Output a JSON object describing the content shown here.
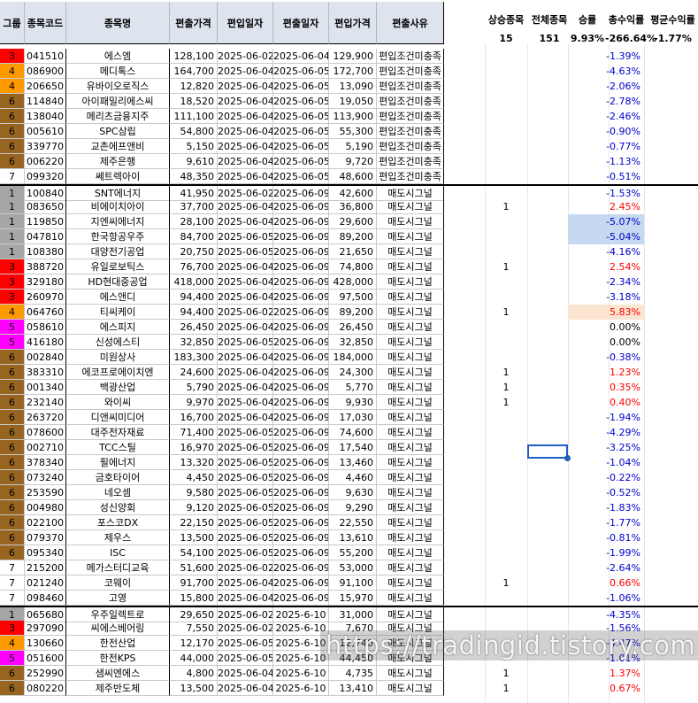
{
  "colors": {
    "grade_1": "#a6a6a6",
    "grade_3": "#ff0000",
    "grade_4": "#ff9900",
    "grade_5": "#ff00ff",
    "grade_6": "#976520",
    "grade_7": "#ffffff",
    "header_bg": "#dde4ee",
    "positive": "#ff0000",
    "negative": "#0000cc",
    "zero": "#000000",
    "highlight_blue": "#c5d9f1",
    "highlight_orange": "#fbe4d0"
  },
  "headers": [
    "그룹",
    "종목코드",
    "종목명",
    "편출가격",
    "편입일자",
    "편출일자",
    "편입가격",
    "편출사유"
  ],
  "summary": {
    "labels": [
      "상승종목",
      "전체종목",
      "승률",
      "총수익률",
      "평균수익률"
    ],
    "values": [
      "15",
      "151",
      "9.93%",
      "-266.64%",
      "-1.77%"
    ]
  },
  "rows": [
    {
      "grp": "3",
      "code": "041510",
      "name": "에스엠",
      "sell": "128,100",
      "in": "2025-06-02",
      "out": "2025-06-04",
      "buy": "129,900",
      "reason": "편입조건미충족",
      "up": "",
      "ret": "-1.39%"
    },
    {
      "grp": "4",
      "code": "086900",
      "name": "메디톡스",
      "sell": "164,700",
      "in": "2025-06-04",
      "out": "2025-06-05",
      "buy": "172,700",
      "reason": "편입조건미충족",
      "up": "",
      "ret": "-4.63%"
    },
    {
      "grp": "4",
      "code": "206650",
      "name": "유바이오로직스",
      "sell": "12,820",
      "in": "2025-06-04",
      "out": "2025-06-05",
      "buy": "13,090",
      "reason": "편입조건미충족",
      "up": "",
      "ret": "-2.06%"
    },
    {
      "grp": "6",
      "code": "114840",
      "name": "아이패밀리에스씨",
      "sell": "18,520",
      "in": "2025-06-04",
      "out": "2025-06-05",
      "buy": "19,050",
      "reason": "편입조건미충족",
      "up": "",
      "ret": "-2.78%"
    },
    {
      "grp": "6",
      "code": "138040",
      "name": "메리츠금융지주",
      "sell": "111,100",
      "in": "2025-06-04",
      "out": "2025-06-05",
      "buy": "113,900",
      "reason": "편입조건미충족",
      "up": "",
      "ret": "-2.46%"
    },
    {
      "grp": "6",
      "code": "005610",
      "name": "SPC삼립",
      "sell": "54,800",
      "in": "2025-06-04",
      "out": "2025-06-05",
      "buy": "55,300",
      "reason": "편입조건미충족",
      "up": "",
      "ret": "-0.90%"
    },
    {
      "grp": "6",
      "code": "339770",
      "name": "교촌에프앤비",
      "sell": "5,150",
      "in": "2025-06-04",
      "out": "2025-06-05",
      "buy": "5,190",
      "reason": "편입조건미충족",
      "up": "",
      "ret": "-0.77%"
    },
    {
      "grp": "6",
      "code": "006220",
      "name": "제주은행",
      "sell": "9,610",
      "in": "2025-06-04",
      "out": "2025-06-05",
      "buy": "9,720",
      "reason": "편입조건미충족",
      "up": "",
      "ret": "-1.13%"
    },
    {
      "grp": "7",
      "code": "099320",
      "name": "쎄트렉아이",
      "sell": "48,350",
      "in": "2025-06-04",
      "out": "2025-06-05",
      "buy": "48,600",
      "reason": "편입조건미충족",
      "up": "",
      "ret": "-0.51%"
    },
    {
      "grp": "1",
      "code": "100840",
      "name": "SNT에너지",
      "sell": "41,950",
      "in": "2025-06-02",
      "out": "2025-06-09",
      "buy": "42,600",
      "reason": "매도시그널",
      "up": "",
      "ret": "-1.53%"
    },
    {
      "grp": "1",
      "code": "083650",
      "name": "비에이치아이",
      "sell": "37,700",
      "in": "2025-06-04",
      "out": "2025-06-09",
      "buy": "36,800",
      "reason": "매도시그널",
      "up": "1",
      "ret": "2.45%"
    },
    {
      "grp": "1",
      "code": "119850",
      "name": "지엔씨에너지",
      "sell": "28,100",
      "in": "2025-06-04",
      "out": "2025-06-09",
      "buy": "29,600",
      "reason": "매도시그널",
      "up": "",
      "ret": "-5.07%",
      "hl": "blue"
    },
    {
      "grp": "1",
      "code": "047810",
      "name": "한국항공우주",
      "sell": "84,700",
      "in": "2025-06-05",
      "out": "2025-06-09",
      "buy": "89,200",
      "reason": "매도시그널",
      "up": "",
      "ret": "-5.04%",
      "hl": "blue"
    },
    {
      "grp": "1",
      "code": "108380",
      "name": "대양전기공업",
      "sell": "20,750",
      "in": "2025-06-05",
      "out": "2025-06-09",
      "buy": "21,650",
      "reason": "매도시그널",
      "up": "",
      "ret": "-4.16%"
    },
    {
      "grp": "3",
      "code": "388720",
      "name": "유일로보틱스",
      "sell": "76,700",
      "in": "2025-06-04",
      "out": "2025-06-09",
      "buy": "74,800",
      "reason": "매도시그널",
      "up": "1",
      "ret": "2.54%"
    },
    {
      "grp": "3",
      "code": "329180",
      "name": "HD현대중공업",
      "sell": "418,000",
      "in": "2025-06-04",
      "out": "2025-06-09",
      "buy": "428,000",
      "reason": "매도시그널",
      "up": "",
      "ret": "-2.34%"
    },
    {
      "grp": "3",
      "code": "260970",
      "name": "에스앤디",
      "sell": "94,400",
      "in": "2025-06-04",
      "out": "2025-06-09",
      "buy": "97,500",
      "reason": "매도시그널",
      "up": "",
      "ret": "-3.18%"
    },
    {
      "grp": "4",
      "code": "064760",
      "name": "티씨케이",
      "sell": "94,400",
      "in": "2025-06-02",
      "out": "2025-06-09",
      "buy": "89,200",
      "reason": "매도시그널",
      "up": "1",
      "ret": "5.83%",
      "hl": "orange"
    },
    {
      "grp": "5",
      "code": "058610",
      "name": "에스피지",
      "sell": "26,450",
      "in": "2025-06-04",
      "out": "2025-06-09",
      "buy": "26,450",
      "reason": "매도시그널",
      "up": "",
      "ret": "0.00%"
    },
    {
      "grp": "5",
      "code": "416180",
      "name": "신성에스티",
      "sell": "32,850",
      "in": "2025-06-05",
      "out": "2025-06-09",
      "buy": "32,850",
      "reason": "매도시그널",
      "up": "",
      "ret": "0.00%"
    },
    {
      "grp": "6",
      "code": "002840",
      "name": "미원상사",
      "sell": "183,300",
      "in": "2025-06-04",
      "out": "2025-06-09",
      "buy": "184,000",
      "reason": "매도시그널",
      "up": "",
      "ret": "-0.38%"
    },
    {
      "grp": "6",
      "code": "383310",
      "name": "에코프로에이치엔",
      "sell": "24,600",
      "in": "2025-06-04",
      "out": "2025-06-09",
      "buy": "24,300",
      "reason": "매도시그널",
      "up": "1",
      "ret": "1.23%"
    },
    {
      "grp": "6",
      "code": "001340",
      "name": "백광산업",
      "sell": "5,790",
      "in": "2025-06-04",
      "out": "2025-06-09",
      "buy": "5,770",
      "reason": "매도시그널",
      "up": "1",
      "ret": "0.35%"
    },
    {
      "grp": "6",
      "code": "232140",
      "name": "와이씨",
      "sell": "9,970",
      "in": "2025-06-04",
      "out": "2025-06-09",
      "buy": "9,930",
      "reason": "매도시그널",
      "up": "1",
      "ret": "0.40%"
    },
    {
      "grp": "6",
      "code": "263720",
      "name": "디앤씨미디어",
      "sell": "16,700",
      "in": "2025-06-04",
      "out": "2025-06-09",
      "buy": "17,030",
      "reason": "매도시그널",
      "up": "",
      "ret": "-1.94%"
    },
    {
      "grp": "6",
      "code": "078600",
      "name": "대주전자재료",
      "sell": "71,400",
      "in": "2025-06-05",
      "out": "2025-06-09",
      "buy": "74,600",
      "reason": "매도시그널",
      "up": "",
      "ret": "-4.29%"
    },
    {
      "grp": "6",
      "code": "002710",
      "name": "TCC스틸",
      "sell": "16,970",
      "in": "2025-06-05",
      "out": "2025-06-09",
      "buy": "17,540",
      "reason": "매도시그널",
      "up": "",
      "ret": "-3.25%"
    },
    {
      "grp": "6",
      "code": "378340",
      "name": "필에너지",
      "sell": "13,320",
      "in": "2025-06-05",
      "out": "2025-06-09",
      "buy": "13,460",
      "reason": "매도시그널",
      "up": "",
      "ret": "-1.04%"
    },
    {
      "grp": "6",
      "code": "073240",
      "name": "금호타이어",
      "sell": "4,450",
      "in": "2025-06-05",
      "out": "2025-06-09",
      "buy": "4,460",
      "reason": "매도시그널",
      "up": "",
      "ret": "-0.22%"
    },
    {
      "grp": "6",
      "code": "253590",
      "name": "네오셈",
      "sell": "9,580",
      "in": "2025-06-05",
      "out": "2025-06-09",
      "buy": "9,630",
      "reason": "매도시그널",
      "up": "",
      "ret": "-0.52%"
    },
    {
      "grp": "6",
      "code": "004980",
      "name": "성신양회",
      "sell": "9,120",
      "in": "2025-06-05",
      "out": "2025-06-09",
      "buy": "9,290",
      "reason": "매도시그널",
      "up": "",
      "ret": "-1.83%"
    },
    {
      "grp": "6",
      "code": "022100",
      "name": "포스코DX",
      "sell": "22,150",
      "in": "2025-06-05",
      "out": "2025-06-09",
      "buy": "22,550",
      "reason": "매도시그널",
      "up": "",
      "ret": "-1.77%"
    },
    {
      "grp": "6",
      "code": "079370",
      "name": "제우스",
      "sell": "13,500",
      "in": "2025-06-05",
      "out": "2025-06-09",
      "buy": "13,610",
      "reason": "매도시그널",
      "up": "",
      "ret": "-0.81%"
    },
    {
      "grp": "6",
      "code": "095340",
      "name": "ISC",
      "sell": "54,100",
      "in": "2025-06-05",
      "out": "2025-06-09",
      "buy": "55,200",
      "reason": "매도시그널",
      "up": "",
      "ret": "-1.99%"
    },
    {
      "grp": "7",
      "code": "215200",
      "name": "메가스터디교육",
      "sell": "51,600",
      "in": "2025-06-02",
      "out": "2025-06-09",
      "buy": "53,000",
      "reason": "매도시그널",
      "up": "",
      "ret": "-2.64%"
    },
    {
      "grp": "7",
      "code": "021240",
      "name": "코웨이",
      "sell": "91,700",
      "in": "2025-06-04",
      "out": "2025-06-09",
      "buy": "91,100",
      "reason": "매도시그널",
      "up": "1",
      "ret": "0.66%"
    },
    {
      "grp": "7",
      "code": "098460",
      "name": "고영",
      "sell": "15,800",
      "in": "2025-06-04",
      "out": "2025-06-09",
      "buy": "15,970",
      "reason": "매도시그널",
      "up": "",
      "ret": "-1.06%"
    },
    {
      "grp": "1",
      "code": "065680",
      "name": "우주일렉트로",
      "sell": "29,650",
      "in": "2025-06-02",
      "out": "2025-6-10",
      "buy": "31,000",
      "reason": "매도시그널",
      "up": "",
      "ret": "-4.35%"
    },
    {
      "grp": "3",
      "code": "297090",
      "name": "씨에스베어링",
      "sell": "7,550",
      "in": "2025-06-02",
      "out": "2025-6-10",
      "buy": "7,670",
      "reason": "매도시그널",
      "up": "",
      "ret": "-1.56%"
    },
    {
      "grp": "4",
      "code": "130660",
      "name": "한전산업",
      "sell": "12,170",
      "in": "2025-06-05",
      "out": "2025-6-10",
      "buy": "12,740",
      "reason": "매도시그널",
      "up": "",
      "ret": "-4.47%"
    },
    {
      "grp": "5",
      "code": "051600",
      "name": "한전KPS",
      "sell": "44,000",
      "in": "2025-06-05",
      "out": "2025-6-10",
      "buy": "44,450",
      "reason": "매도시그널",
      "up": "",
      "ret": "-1.01%"
    },
    {
      "grp": "6",
      "code": "252990",
      "name": "샘씨엔에스",
      "sell": "4,800",
      "in": "2025-06-04",
      "out": "2025-6-10",
      "buy": "4,735",
      "reason": "매도시그널",
      "up": "1",
      "ret": "1.37%"
    },
    {
      "grp": "6",
      "code": "080220",
      "name": "제주반도체",
      "sell": "13,500",
      "in": "2025-06-04",
      "out": "2025-6-10",
      "buy": "13,410",
      "reason": "매도시그널",
      "up": "1",
      "ret": "0.67%"
    }
  ],
  "watermark": "https://tradingid.tistory.com"
}
